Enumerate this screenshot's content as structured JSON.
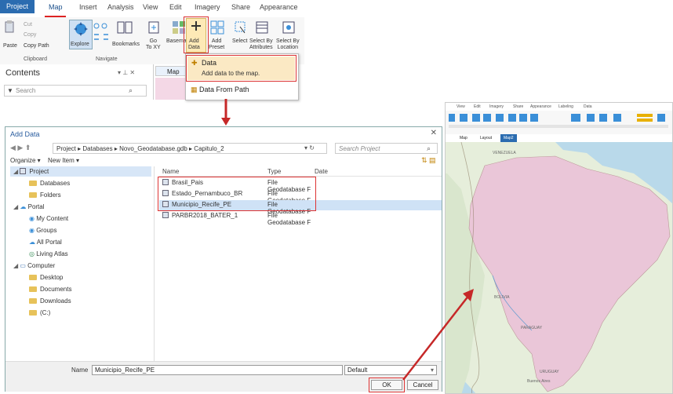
{
  "ribbon": {
    "tabs": {
      "project": "Project",
      "map": "Map",
      "insert": "Insert",
      "analysis": "Analysis",
      "view": "View",
      "edit": "Edit",
      "imagery": "Imagery",
      "share": "Share",
      "appearance": "Appearance"
    },
    "clipboard": {
      "cut": "Cut",
      "copy": "Copy",
      "paste": "Paste",
      "copy_path": "Copy Path",
      "group": "Clipboard"
    },
    "navigate": {
      "explore": "Explore",
      "bookmarks": "Bookmarks",
      "go_to_xy": "Go\nTo XY",
      "group": "Navigate"
    },
    "layer": {
      "basemap": "Basemap",
      "add_data": "Add\nData",
      "add_preset": "Add\nPreset",
      "select": "Select",
      "select_by_attributes": "Select By\nAttributes",
      "select_by_location": "Select By\nLocation"
    }
  },
  "contents": {
    "title": "Contents",
    "search_placeholder": "Search",
    "pin": "▾ ⊥ ✕"
  },
  "map_tab": {
    "label": "Map"
  },
  "dropdown": {
    "item1_title": "Data",
    "item1_desc": "Add data to the map.",
    "item2_title": "Data From Path"
  },
  "dialog": {
    "title": "Add Data",
    "breadcrumb": [
      "Project",
      "Databases",
      "Novo_Geodatabase.gdb",
      "Capitulo_2"
    ],
    "search_placeholder": "Search Project",
    "organize": "Organize ▾",
    "new_item": "New Item ▾",
    "nav": [
      {
        "label": "Project",
        "level": 0,
        "icon": "project"
      },
      {
        "label": "Databases",
        "level": 1,
        "icon": "db"
      },
      {
        "label": "Folders",
        "level": 1,
        "icon": "folder"
      },
      {
        "label": "Portal",
        "level": 0,
        "icon": "portal"
      },
      {
        "label": "My Content",
        "level": 1,
        "icon": "user"
      },
      {
        "label": "Groups",
        "level": 1,
        "icon": "group"
      },
      {
        "label": "All Portal",
        "level": 1,
        "icon": "cloud"
      },
      {
        "label": "Living Atlas",
        "level": 1,
        "icon": "atlas"
      },
      {
        "label": "Computer",
        "level": 0,
        "icon": "computer"
      },
      {
        "label": "Desktop",
        "level": 1,
        "icon": "folder"
      },
      {
        "label": "Documents",
        "level": 1,
        "icon": "folder"
      },
      {
        "label": "Downloads",
        "level": 1,
        "icon": "folder"
      },
      {
        "label": "(C:)",
        "level": 1,
        "icon": "folder"
      }
    ],
    "columns": {
      "name": "Name",
      "type": "Type",
      "date": "Date"
    },
    "files": [
      {
        "name": "Brasil_Pais",
        "type": "File Geodatabase F"
      },
      {
        "name": "Estado_Pernambuco_BR",
        "type": "File Geodatabase F"
      },
      {
        "name": "Municipio_Recife_PE",
        "type": "File Geodatabase F"
      },
      {
        "name": "PARBR2018_BATER_1",
        "type": "File Geodatabase F"
      }
    ],
    "name_label": "Name",
    "name_value": "Municipio_Recife_PE",
    "filter_value": "Default",
    "ok": "OK",
    "cancel": "Cancel"
  },
  "mapwin": {
    "tabs": [
      "View",
      "Edit",
      "Imagery",
      "Share",
      "Appearance",
      "Labeling",
      "Data"
    ],
    "view_tabs": [
      "Map",
      "Layout",
      "Map2"
    ],
    "labels": {
      "venezuela": "VENEZUELA",
      "bolivia": "BOLIVIA",
      "paraguay": "PARAGUAY",
      "uruguay": "URUGUAY",
      "buenos_aires": "Buenos Aires"
    }
  },
  "colors": {
    "accent": "#2b6cb0",
    "highlight": "#d33333",
    "brazil": "#eac6d8",
    "land": "#e6eedb",
    "ocean": "#b9d9ea"
  }
}
